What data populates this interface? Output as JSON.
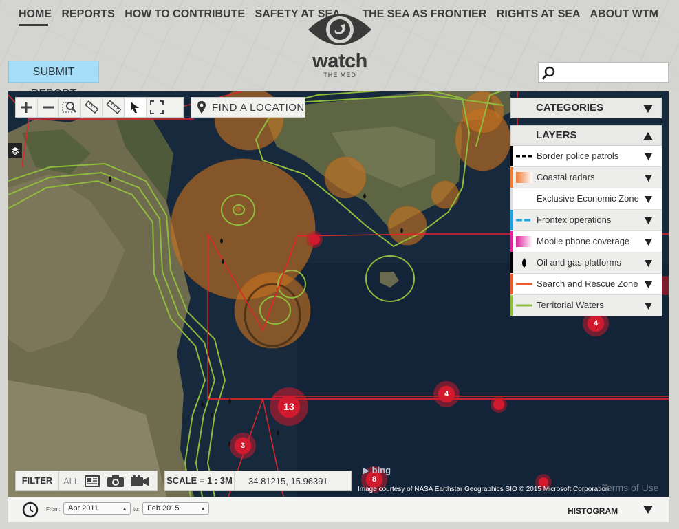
{
  "nav": {
    "left": [
      "HOME",
      "REPORTS",
      "HOW TO CONTRIBUTE",
      "SAFETY AT SEA"
    ],
    "right": [
      "THE SEA AS FRONTIER",
      "RIGHTS AT SEA",
      "ABOUT WTM"
    ]
  },
  "logo": {
    "word": "watch",
    "sub": "THE MED"
  },
  "submit_label": "SUBMIT REPORT",
  "search": {
    "placeholder": ""
  },
  "map": {
    "find_location": "FIND A LOCATION",
    "filter": {
      "label": "FILTER",
      "all": "ALL"
    },
    "scale": "SCALE = 1 : 3M",
    "coords": "34.81215, 15.96391",
    "credit": "Image courtesy of NASA Earthstar Geographics SIO © 2015 Microsoft Corporation",
    "terms": "Terms of Use",
    "bing": "bing",
    "clusters": [
      "13",
      "4",
      "4",
      "3",
      "8"
    ]
  },
  "panel": {
    "categories": "CATEGORIES",
    "layers_title": "LAYERS",
    "layers": [
      {
        "name": "Border police patrols",
        "color": "#000000"
      },
      {
        "name": "Coastal radars",
        "color": "#f07a32"
      },
      {
        "name": "Exclusive Economic Zone",
        "color": "#ffffff"
      },
      {
        "name": "Frontex operations",
        "color": "#1fa3de"
      },
      {
        "name": "Mobile phone coverage",
        "color": "#e0209a"
      },
      {
        "name": "Oil and gas platforms",
        "color": "#000000"
      },
      {
        "name": "Search and Rescue Zone",
        "color": "#ee5a2a"
      },
      {
        "name": "Territorial Waters",
        "color": "#8fbc3c"
      }
    ]
  },
  "timebar": {
    "from_label": "From:",
    "from_value": "Apr 2011",
    "to_label": "to:",
    "to_value": "Feb 2015",
    "histogram": "HISTOGRAM"
  }
}
